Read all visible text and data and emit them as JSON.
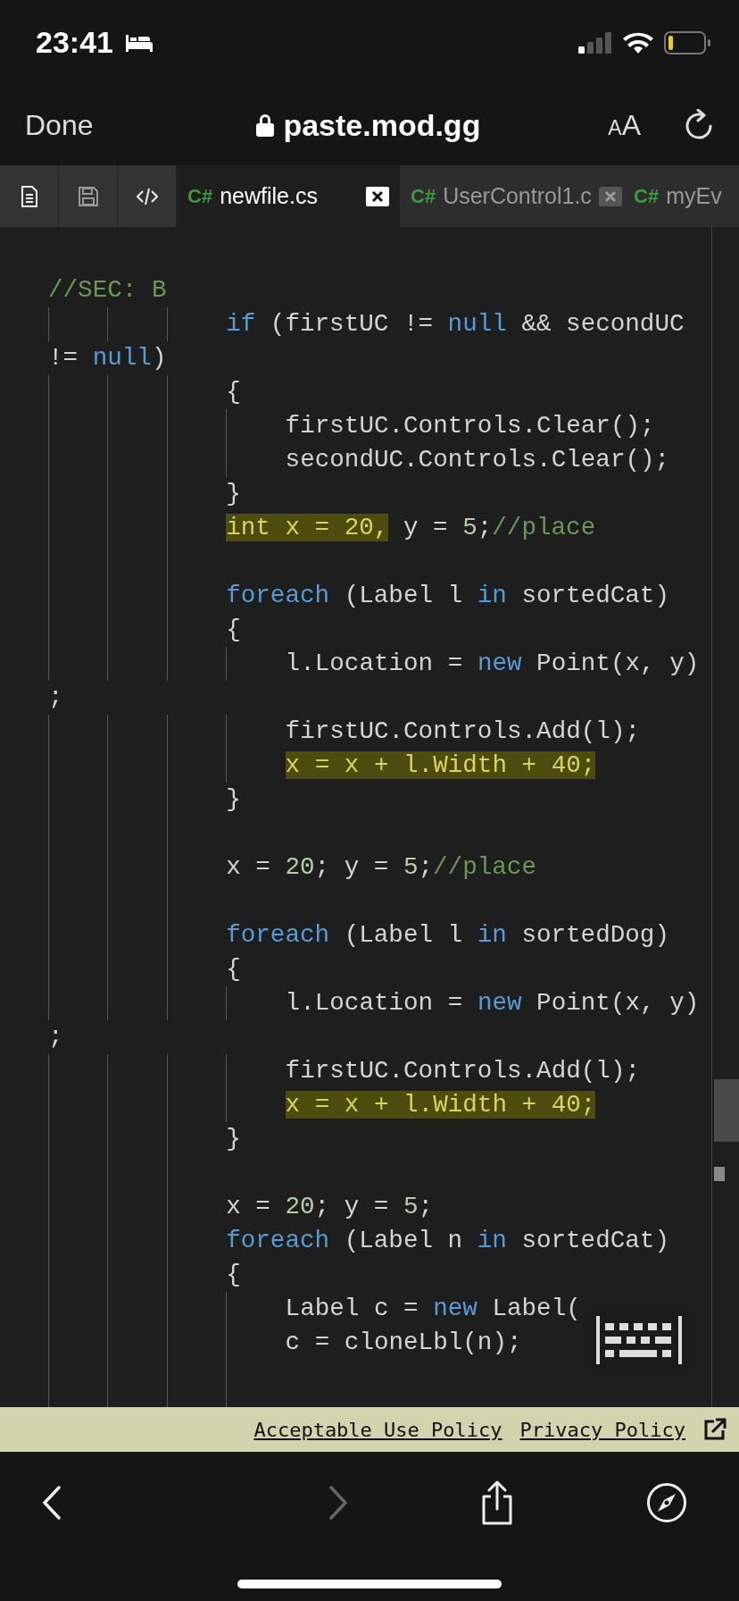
{
  "status_bar": {
    "time": "23:41"
  },
  "browser": {
    "done": "Done",
    "url": "paste.mod.gg",
    "text_size": "AA"
  },
  "tabs": [
    {
      "lang": "C#",
      "name": "newfile.cs",
      "selected": true,
      "closable": true
    },
    {
      "lang": "C#",
      "name": "UserControl1.c",
      "selected": false,
      "closable": true
    },
    {
      "lang": "C#",
      "name": "myEv",
      "selected": false,
      "closable": false
    }
  ],
  "code_lines": [
    {
      "kind": "blank"
    },
    {
      "kind": "code",
      "tokens": [
        {
          "text": "//SEC: B",
          "kind": "comment",
          "highlighted": false
        }
      ]
    },
    {
      "kind": "code",
      "tokens": [
        {
          "text": "            if",
          "kind": "keyword",
          "highlighted": false
        },
        {
          "text": " (firstUC != ",
          "kind": "plain",
          "highlighted": false
        },
        {
          "text": "null",
          "kind": "keyword",
          "highlighted": false
        },
        {
          "text": " && secondUC",
          "kind": "plain",
          "highlighted": false
        }
      ]
    },
    {
      "kind": "code",
      "tokens": [
        {
          "text": "!= ",
          "kind": "plain",
          "highlighted": false
        },
        {
          "text": "null",
          "kind": "keyword",
          "highlighted": false
        },
        {
          "text": ")",
          "kind": "plain",
          "highlighted": false
        }
      ]
    },
    {
      "kind": "code",
      "tokens": [
        {
          "text": "            {",
          "kind": "plain",
          "highlighted": false
        }
      ]
    },
    {
      "kind": "code",
      "tokens": [
        {
          "text": "                firstUC.Controls.Clear();",
          "kind": "plain",
          "highlighted": false
        }
      ]
    },
    {
      "kind": "code",
      "tokens": [
        {
          "text": "                secondUC.Controls.Clear();",
          "kind": "plain",
          "highlighted": false
        }
      ]
    },
    {
      "kind": "code",
      "tokens": [
        {
          "text": "            }",
          "kind": "plain",
          "highlighted": false
        }
      ]
    },
    {
      "kind": "code",
      "tokens": [
        {
          "text": "            int",
          "kind": "type",
          "highlighted": true
        },
        {
          "text": " x = ",
          "kind": "plain",
          "highlighted": true
        },
        {
          "text": "20",
          "kind": "number",
          "highlighted": true
        },
        {
          "text": ",",
          "kind": "plain",
          "highlighted": true
        },
        {
          "text": " y = ",
          "kind": "plain",
          "highlighted": false
        },
        {
          "text": "5",
          "kind": "number",
          "highlighted": false
        },
        {
          "text": ";",
          "kind": "plain",
          "highlighted": false
        },
        {
          "text": "//place",
          "kind": "comment",
          "highlighted": false
        }
      ]
    },
    {
      "kind": "blank"
    },
    {
      "kind": "code",
      "tokens": [
        {
          "text": "            foreach",
          "kind": "keyword",
          "highlighted": false
        },
        {
          "text": " (Label l ",
          "kind": "plain",
          "highlighted": false
        },
        {
          "text": "in",
          "kind": "keyword",
          "highlighted": false
        },
        {
          "text": " sortedCat)",
          "kind": "plain",
          "highlighted": false
        }
      ]
    },
    {
      "kind": "code",
      "tokens": [
        {
          "text": "            {",
          "kind": "plain",
          "highlighted": false
        }
      ]
    },
    {
      "kind": "code",
      "tokens": [
        {
          "text": "                l.Location = ",
          "kind": "plain",
          "highlighted": false
        },
        {
          "text": "new",
          "kind": "keyword",
          "highlighted": false
        },
        {
          "text": " Point(x, y)",
          "kind": "plain",
          "highlighted": false
        }
      ]
    },
    {
      "kind": "code",
      "tokens": [
        {
          "text": ";",
          "kind": "plain",
          "highlighted": false
        }
      ]
    },
    {
      "kind": "code",
      "tokens": [
        {
          "text": "                firstUC.Controls.Add(l);",
          "kind": "plain",
          "highlighted": false
        }
      ]
    },
    {
      "kind": "code",
      "tokens": [
        {
          "text": "                x = x + l.Width + ",
          "kind": "plain",
          "highlighted": true
        },
        {
          "text": "40",
          "kind": "number",
          "highlighted": true
        },
        {
          "text": ";",
          "kind": "plain",
          "highlighted": true
        }
      ]
    },
    {
      "kind": "code",
      "tokens": [
        {
          "text": "            }",
          "kind": "plain",
          "highlighted": false
        }
      ]
    },
    {
      "kind": "blank"
    },
    {
      "kind": "code",
      "tokens": [
        {
          "text": "            x = ",
          "kind": "plain",
          "highlighted": false
        },
        {
          "text": "20",
          "kind": "number",
          "highlighted": false
        },
        {
          "text": "; y = ",
          "kind": "plain",
          "highlighted": false
        },
        {
          "text": "5",
          "kind": "number",
          "highlighted": false
        },
        {
          "text": ";",
          "kind": "plain",
          "highlighted": false
        },
        {
          "text": "//place",
          "kind": "comment",
          "highlighted": false
        }
      ]
    },
    {
      "kind": "blank"
    },
    {
      "kind": "code",
      "tokens": [
        {
          "text": "            foreach",
          "kind": "keyword",
          "highlighted": false
        },
        {
          "text": " (Label l ",
          "kind": "plain",
          "highlighted": false
        },
        {
          "text": "in",
          "kind": "keyword",
          "highlighted": false
        },
        {
          "text": " sortedDog)",
          "kind": "plain",
          "highlighted": false
        }
      ]
    },
    {
      "kind": "code",
      "tokens": [
        {
          "text": "            {",
          "kind": "plain",
          "highlighted": false
        }
      ]
    },
    {
      "kind": "code",
      "tokens": [
        {
          "text": "                l.Location = ",
          "kind": "plain",
          "highlighted": false
        },
        {
          "text": "new",
          "kind": "keyword",
          "highlighted": false
        },
        {
          "text": " Point(x, y)",
          "kind": "plain",
          "highlighted": false
        }
      ]
    },
    {
      "kind": "code",
      "tokens": [
        {
          "text": ";",
          "kind": "plain",
          "highlighted": false
        }
      ]
    },
    {
      "kind": "code",
      "tokens": [
        {
          "text": "                firstUC.Controls.Add(l);",
          "kind": "plain",
          "highlighted": false
        }
      ]
    },
    {
      "kind": "code",
      "tokens": [
        {
          "text": "                x = x + l.Width + ",
          "kind": "plain",
          "highlighted": true
        },
        {
          "text": "40",
          "kind": "number",
          "highlighted": true
        },
        {
          "text": ";",
          "kind": "plain",
          "highlighted": true
        }
      ]
    },
    {
      "kind": "code",
      "tokens": [
        {
          "text": "            }",
          "kind": "plain",
          "highlighted": false
        }
      ]
    },
    {
      "kind": "blank"
    },
    {
      "kind": "code",
      "tokens": [
        {
          "text": "            x = ",
          "kind": "plain",
          "highlighted": false
        },
        {
          "text": "20",
          "kind": "number",
          "highlighted": false
        },
        {
          "text": "; y = ",
          "kind": "plain",
          "highlighted": false
        },
        {
          "text": "5",
          "kind": "number",
          "highlighted": false
        },
        {
          "text": ";",
          "kind": "plain",
          "highlighted": false
        }
      ]
    },
    {
      "kind": "code",
      "tokens": [
        {
          "text": "            foreach",
          "kind": "keyword",
          "highlighted": false
        },
        {
          "text": " (Label n ",
          "kind": "plain",
          "highlighted": false
        },
        {
          "text": "in",
          "kind": "keyword",
          "highlighted": false
        },
        {
          "text": " sortedCat)",
          "kind": "plain",
          "highlighted": false
        }
      ]
    },
    {
      "kind": "code",
      "tokens": [
        {
          "text": "            {",
          "kind": "plain",
          "highlighted": false
        }
      ]
    },
    {
      "kind": "code",
      "tokens": [
        {
          "text": "                Label c = ",
          "kind": "plain",
          "highlighted": false
        },
        {
          "text": "new",
          "kind": "keyword",
          "highlighted": false
        },
        {
          "text": " Label(",
          "kind": "plain",
          "highlighted": false
        }
      ]
    },
    {
      "kind": "code",
      "tokens": [
        {
          "text": "                c = cloneLbl(n);",
          "kind": "plain",
          "highlighted": false
        }
      ]
    }
  ],
  "footer": {
    "links": [
      "Acceptable Use Policy",
      "Privacy Policy"
    ]
  },
  "navigation": {
    "back_enabled": true,
    "forward_enabled": false
  }
}
